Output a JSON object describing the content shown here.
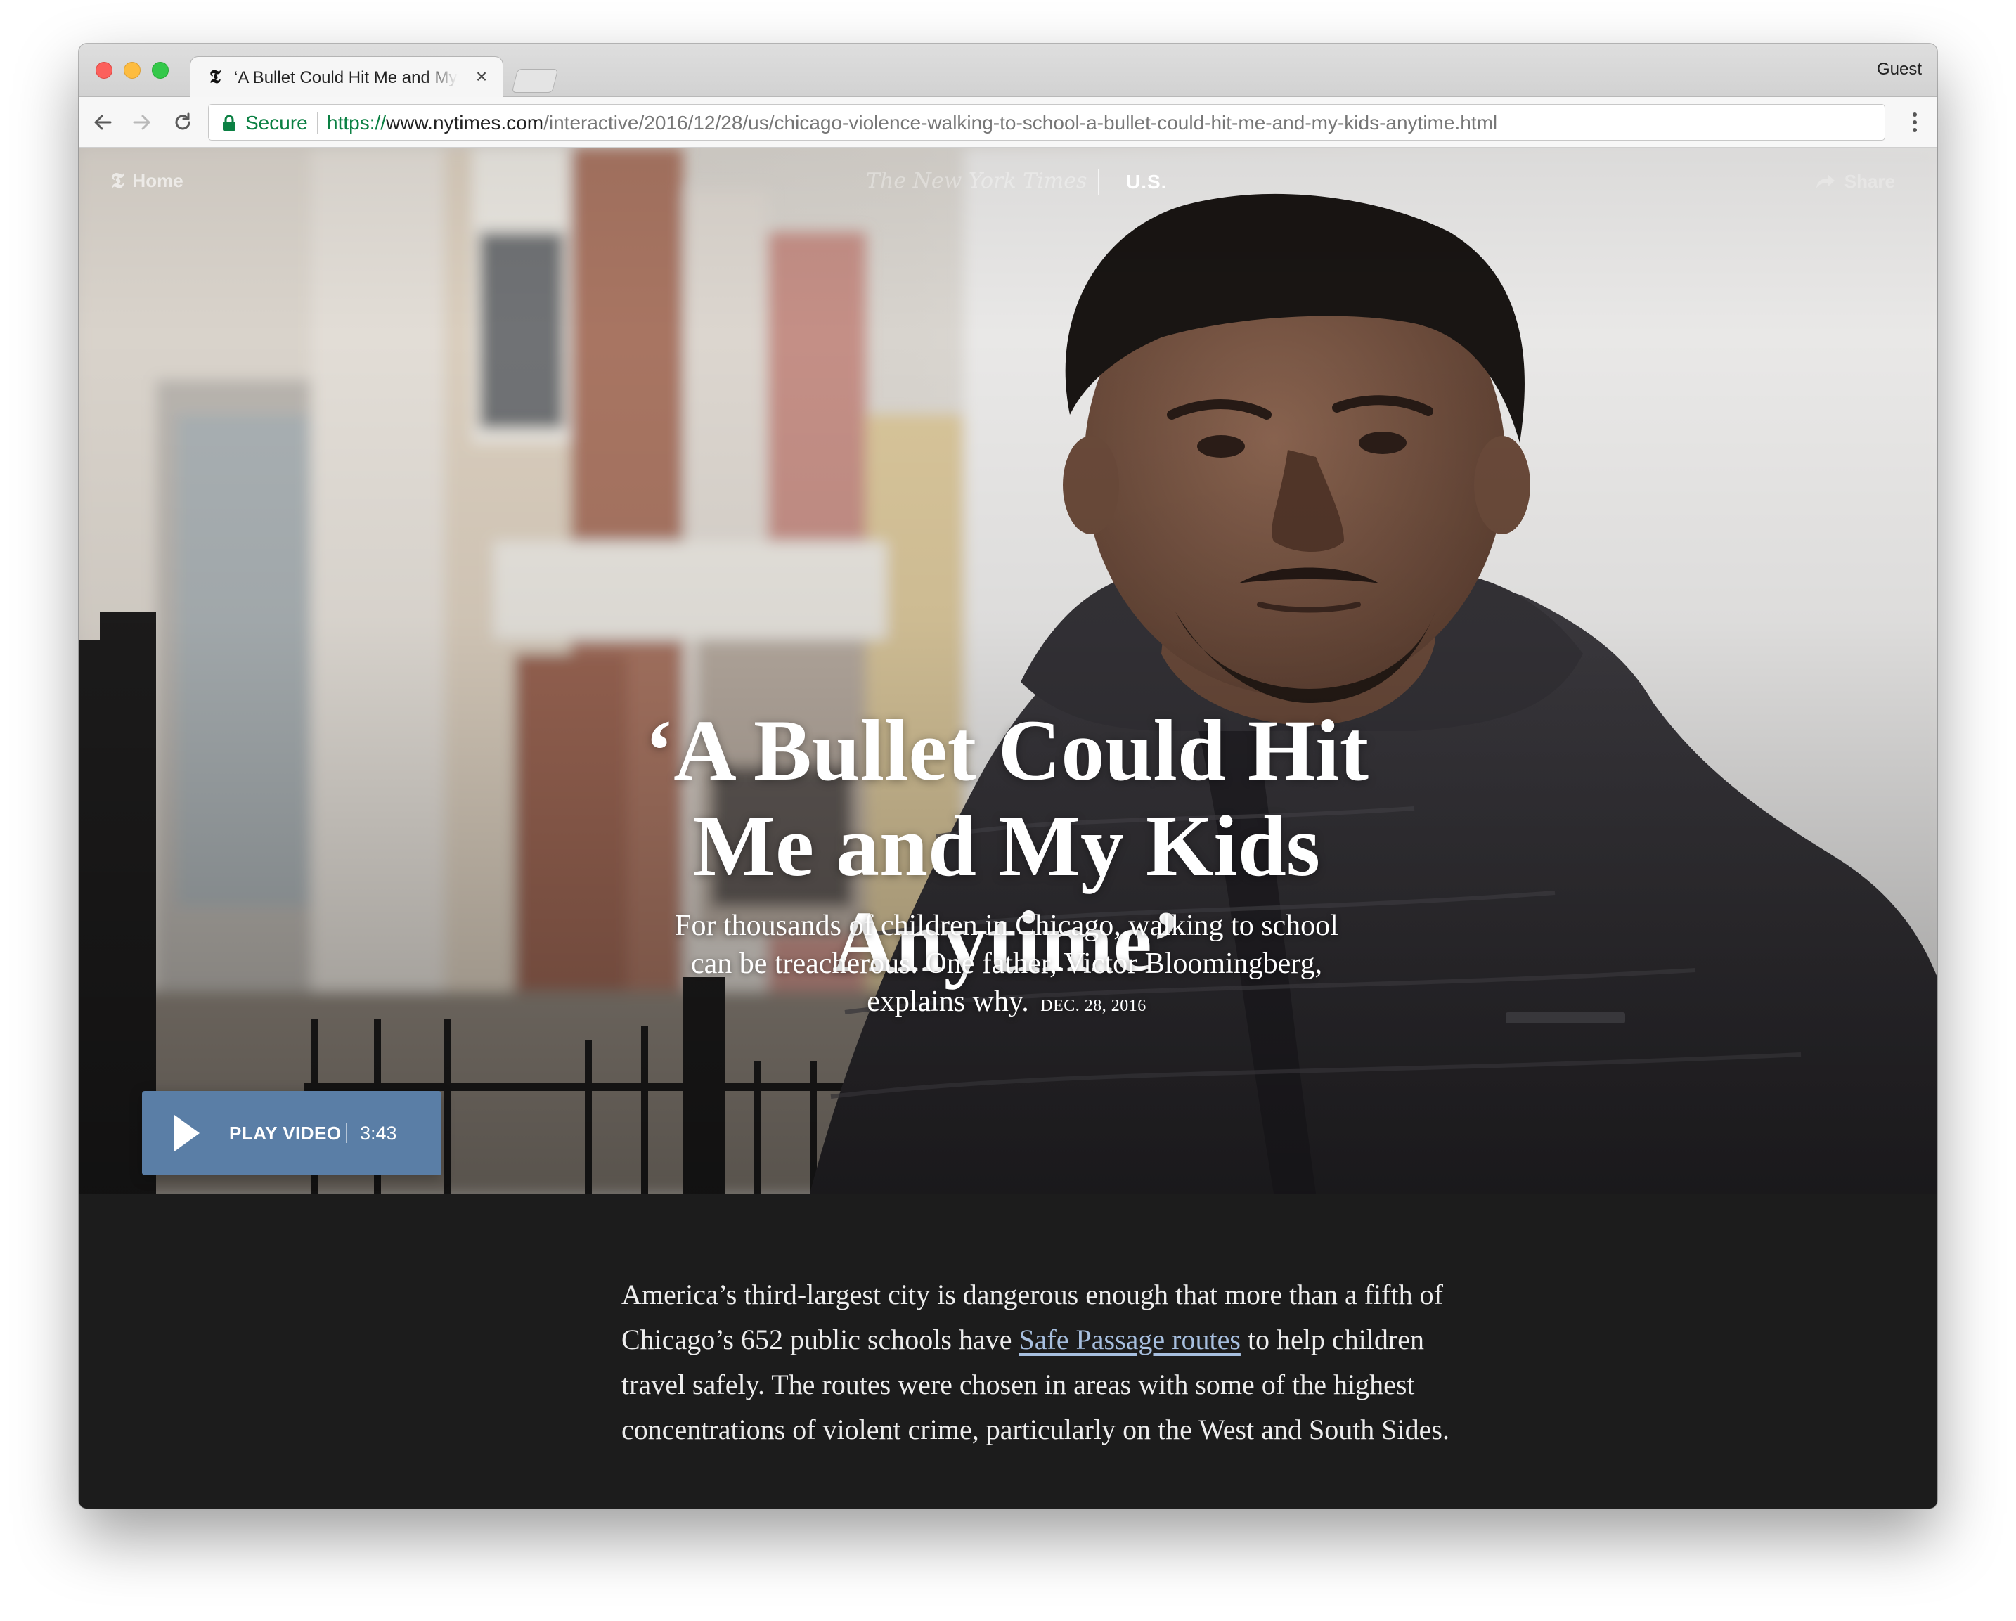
{
  "browser": {
    "tab": {
      "title": "‘A Bullet Could Hit Me and My Kids Anytime’ - The New York Times",
      "favicon": "nyt-t-icon",
      "close": "×"
    },
    "profile": "Guest",
    "toolbar": {
      "secure_label": "Secure",
      "url_scheme": "https://",
      "url_host": "www.nytimes.com",
      "url_path": "/interactive/2016/12/28/us/chicago-violence-walking-to-school-a-bullet-could-hit-me-and-my-kids-anytime.html",
      "secure_color": "#0b8043"
    }
  },
  "site_nav": {
    "home_icon": "𝕿",
    "home_label": "Home",
    "masthead": "The New York Times",
    "section": "U.S.",
    "share_label": "Share"
  },
  "hero": {
    "headline": "‘A Bullet Could Hit Me and My Kids Anytime’",
    "deck": "For thousands of children in Chicago, walking to school can be treacherous. One father, Victor Bloomingberg, explains why.",
    "dateline": "DEC. 28, 2016",
    "play_label": "PLAY VIDEO",
    "duration": "3:43",
    "play_button_color": "#5a7ea6"
  },
  "article": {
    "p1_before": "America’s third-largest city is dangerous enough that more than a fifth of Chicago’s 652 public schools have ",
    "p1_link": "Safe Passage routes",
    "p1_after": " to help children travel safely. The routes were chosen in areas with some of the highest concentrations of violent crime, particularly on the West and South Sides.",
    "link_color": "#a7bfdf"
  }
}
